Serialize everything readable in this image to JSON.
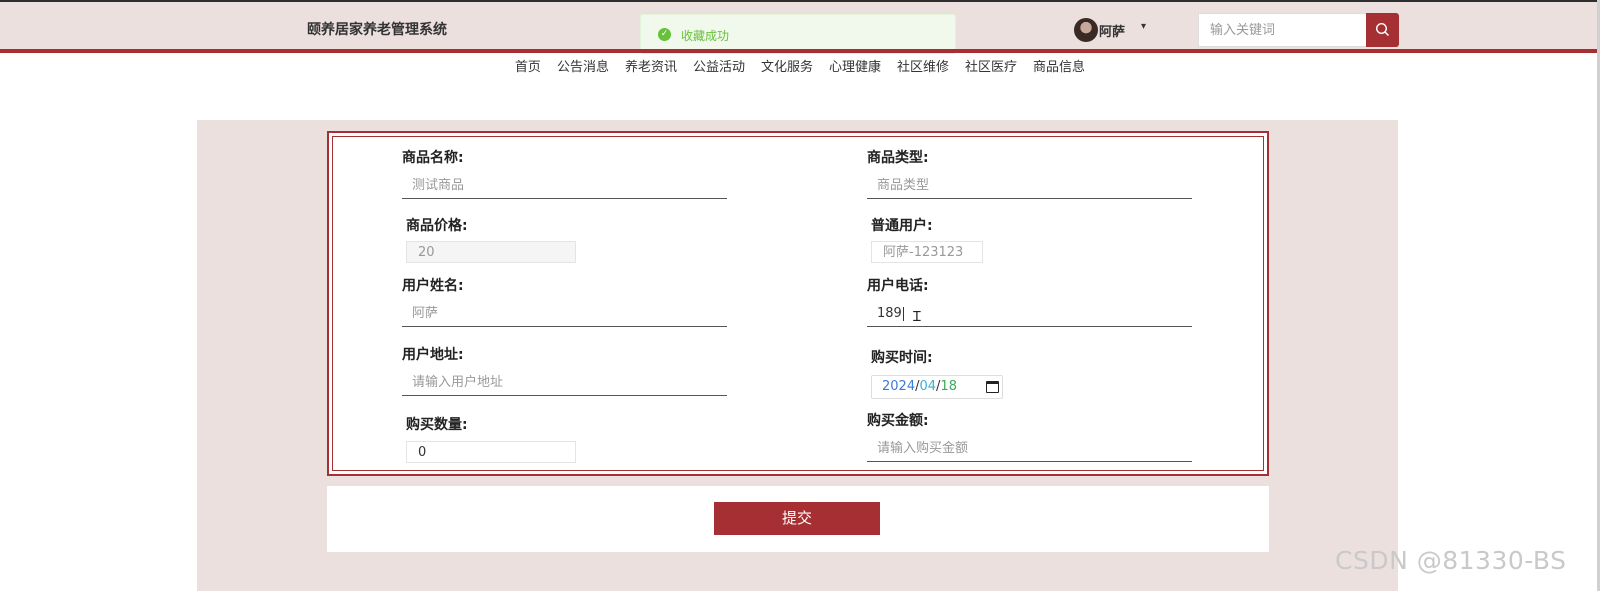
{
  "header": {
    "site_title": "颐养居家养老管理系统",
    "username": "阿萨",
    "caret": "▾",
    "search_placeholder": "输入关键词"
  },
  "toast": {
    "icon": "check-circle-icon",
    "message": "收藏成功",
    "color": "#67c23a"
  },
  "nav": {
    "items": [
      "首页",
      "公告消息",
      "养老资讯",
      "公益活动",
      "文化服务",
      "心理健康",
      "社区维修",
      "社区医疗",
      "商品信息"
    ]
  },
  "form": {
    "product_name": {
      "label": "商品名称:",
      "value": "测试商品"
    },
    "product_type": {
      "label": "商品类型:",
      "placeholder": "商品类型"
    },
    "price": {
      "label": "商品价格:",
      "value": "20"
    },
    "regular_user": {
      "label": "普通用户:",
      "value": "阿萨-123123"
    },
    "user_name": {
      "label": "用户姓名:",
      "value": "阿萨"
    },
    "user_phone": {
      "label": "用户电话:",
      "value": "189"
    },
    "user_address": {
      "label": "用户地址:",
      "placeholder": "请输入用户地址"
    },
    "purchase_time": {
      "label": "购买时间:",
      "year": "2024",
      "month": "04",
      "day": "18",
      "sep": "/"
    },
    "quantity": {
      "label": "购买数量:",
      "value": "0"
    },
    "amount": {
      "label": "购买金额:",
      "placeholder": "请输入购买金额"
    },
    "submit_label": "提交"
  },
  "colors": {
    "accent": "#a52f32",
    "background": "#ece0df"
  },
  "watermark": "CSDN @81330-BS"
}
